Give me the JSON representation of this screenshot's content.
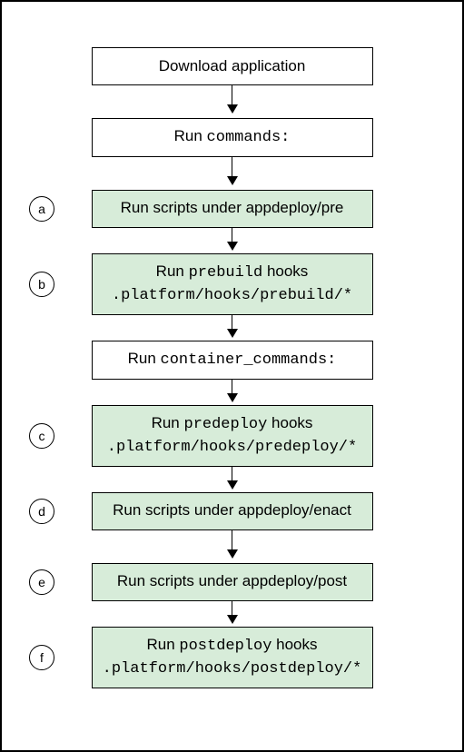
{
  "steps": [
    {
      "label": null,
      "green": false,
      "lines": [
        {
          "segments": [
            {
              "text": "Download application",
              "code": false
            }
          ]
        }
      ]
    },
    {
      "label": null,
      "green": false,
      "lines": [
        {
          "segments": [
            {
              "text": "Run ",
              "code": false
            },
            {
              "text": "commands:",
              "code": true
            }
          ]
        }
      ]
    },
    {
      "label": "a",
      "green": true,
      "lines": [
        {
          "segments": [
            {
              "text": "Run scripts under appdeploy/pre",
              "code": false
            }
          ]
        }
      ]
    },
    {
      "label": "b",
      "green": true,
      "lines": [
        {
          "segments": [
            {
              "text": "Run ",
              "code": false
            },
            {
              "text": "prebuild",
              "code": true
            },
            {
              "text": " hooks",
              "code": false
            }
          ]
        },
        {
          "segments": [
            {
              "text": ".platform/hooks/prebuild/*",
              "code": true
            }
          ]
        }
      ]
    },
    {
      "label": null,
      "green": false,
      "lines": [
        {
          "segments": [
            {
              "text": "Run ",
              "code": false
            },
            {
              "text": "container_commands:",
              "code": true
            }
          ]
        }
      ]
    },
    {
      "label": "c",
      "green": true,
      "lines": [
        {
          "segments": [
            {
              "text": "Run ",
              "code": false
            },
            {
              "text": "predeploy",
              "code": true
            },
            {
              "text": " hooks",
              "code": false
            }
          ]
        },
        {
          "segments": [
            {
              "text": ".platform/hooks/predeploy/*",
              "code": true
            }
          ]
        }
      ]
    },
    {
      "label": "d",
      "green": true,
      "lines": [
        {
          "segments": [
            {
              "text": "Run scripts under appdeploy/enact",
              "code": false
            }
          ]
        }
      ]
    },
    {
      "label": "e",
      "green": true,
      "lines": [
        {
          "segments": [
            {
              "text": "Run scripts under appdeploy/post",
              "code": false
            }
          ]
        }
      ]
    },
    {
      "label": "f",
      "green": true,
      "lines": [
        {
          "segments": [
            {
              "text": "Run ",
              "code": false
            },
            {
              "text": "postdeploy",
              "code": true
            },
            {
              "text": " hooks",
              "code": false
            }
          ]
        },
        {
          "segments": [
            {
              "text": ".platform/hooks/postdeploy/*",
              "code": true
            }
          ]
        }
      ]
    }
  ]
}
